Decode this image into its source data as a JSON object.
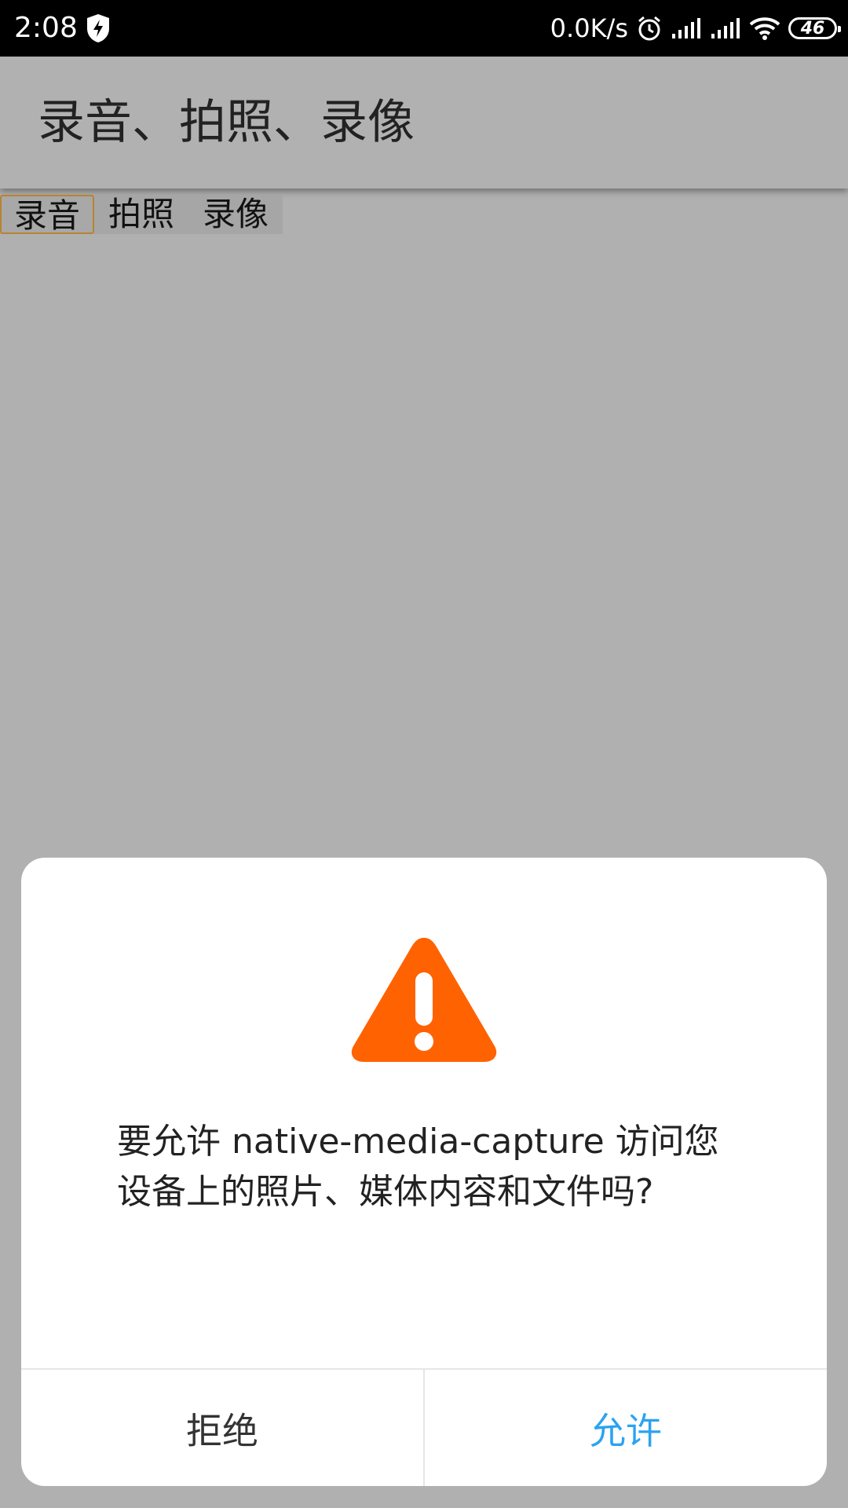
{
  "status_bar": {
    "time": "2:08",
    "net_speed": "0.0K/s",
    "battery": "46",
    "icons": [
      "shield-bolt-icon",
      "alarm-icon",
      "signal-icon",
      "signal-icon",
      "wifi-icon",
      "battery-icon"
    ]
  },
  "app_bar": {
    "title": "录音、拍照、录像"
  },
  "buttons": {
    "record_audio": "录音",
    "take_photo": "拍照",
    "record_video": "录像"
  },
  "dialog": {
    "icon": "warning-icon",
    "icon_color": "#ff6200",
    "message": "要允许 native-media-capture 访问您设备上的照片、媒体内容和文件吗?",
    "deny_label": "拒绝",
    "allow_label": "允许",
    "allow_color": "#2aa3f0"
  }
}
